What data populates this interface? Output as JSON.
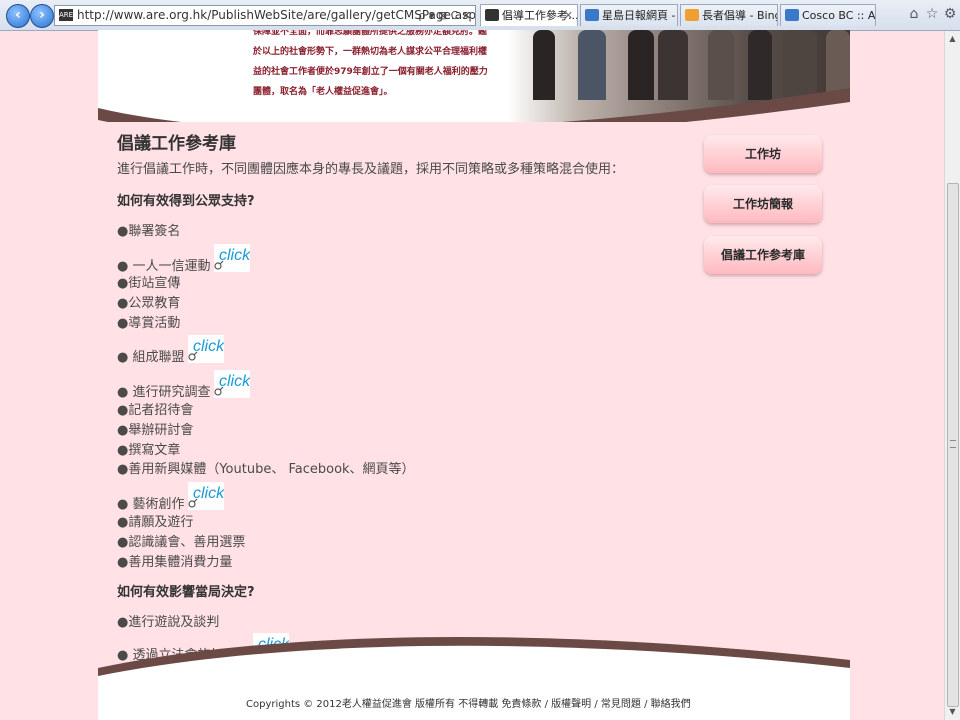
{
  "browser": {
    "back_icon": "back-arrow",
    "forward_icon": "forward-arrow",
    "address": "http://www.are.org.hk/PublishWebSite/are/gallery/getCMSPage.asp?url=/F",
    "address_controls": "ρ ▾ ⊠ C ✕",
    "tabs": [
      {
        "label": "倡導工作參考...",
        "active": true,
        "icon_color": "#333333"
      },
      {
        "label": "星島日報網頁 - ...",
        "active": false,
        "icon_color": "#3a78c9"
      },
      {
        "label": "長者倡導 - Bing",
        "active": false,
        "icon_color": "#f0a030"
      },
      {
        "label": "Cosco BC :: Arc...",
        "active": false,
        "icon_color": "#3a78c9"
      }
    ],
    "toolbar_icons": [
      "home-icon",
      "favorites-star-icon",
      "tools-gear-icon"
    ]
  },
  "banner": {
    "lines": [
      "保障並不全面，而靠志願團體所提供之服務亦定額見肘。鑑",
      "於以上的社會形勢下，一群熱切為老人謀求公平合理福利權",
      "益的社會工作者便於979年創立了一個有關老人福利的壓力",
      "團體，取名為「老人權益促進會」。"
    ]
  },
  "main": {
    "title": "倡議工作參考庫",
    "intro": "進行倡議工作時，不同團體因應本身的專長及議題，採用不同策略或多種策略混合使用：",
    "section1": "如何有效得到公眾支持?",
    "items1": [
      {
        "text": "●聯署簽名",
        "click": false
      },
      {
        "text": "● 一人一信運動",
        "click": true
      },
      {
        "text": "●街站宣傳",
        "click": false
      },
      {
        "text": "●公眾教育",
        "click": false
      },
      {
        "text": "●導賞活動",
        "click": false
      },
      {
        "text": "● 組成聯盟",
        "click": true
      },
      {
        "text": "● 進行研究調查",
        "click": true
      },
      {
        "text": "●記者招待會",
        "click": false
      },
      {
        "text": "●舉辦研討會",
        "click": false
      },
      {
        "text": "●撰寫文章",
        "click": false
      },
      {
        "text": "●善用新興媒體（Youtube、 Facebook、網頁等）",
        "click": false
      },
      {
        "text": "● 藝術創作",
        "click": true
      },
      {
        "text": "●請願及遊行",
        "click": false
      },
      {
        "text": "●認識議會、善用選票",
        "click": false
      },
      {
        "text": "●善用集體消費力量",
        "click": false
      }
    ],
    "section2": "如何有效影響當局決定?",
    "items2": [
      {
        "text": "●進行遊說及談判",
        "click": false
      },
      {
        "text": "● 透過立法會施加壓力",
        "click": true
      }
    ],
    "click_label": "click"
  },
  "sidebar": {
    "buttons": [
      "工作坊",
      "工作坊簡報",
      "倡議工作参考庫"
    ]
  },
  "footer": {
    "copyright": "Copyrights © 2012老人權益促進會 版權所有 不得轉載",
    "links": [
      "免責條款",
      "版權聲明",
      "常見問題",
      "聯絡我們"
    ],
    "sep": " / "
  },
  "colors": {
    "page_bg": "#ffe1e6",
    "accent_dark": "#6b4a45",
    "click_blue": "#1a9ad6"
  }
}
